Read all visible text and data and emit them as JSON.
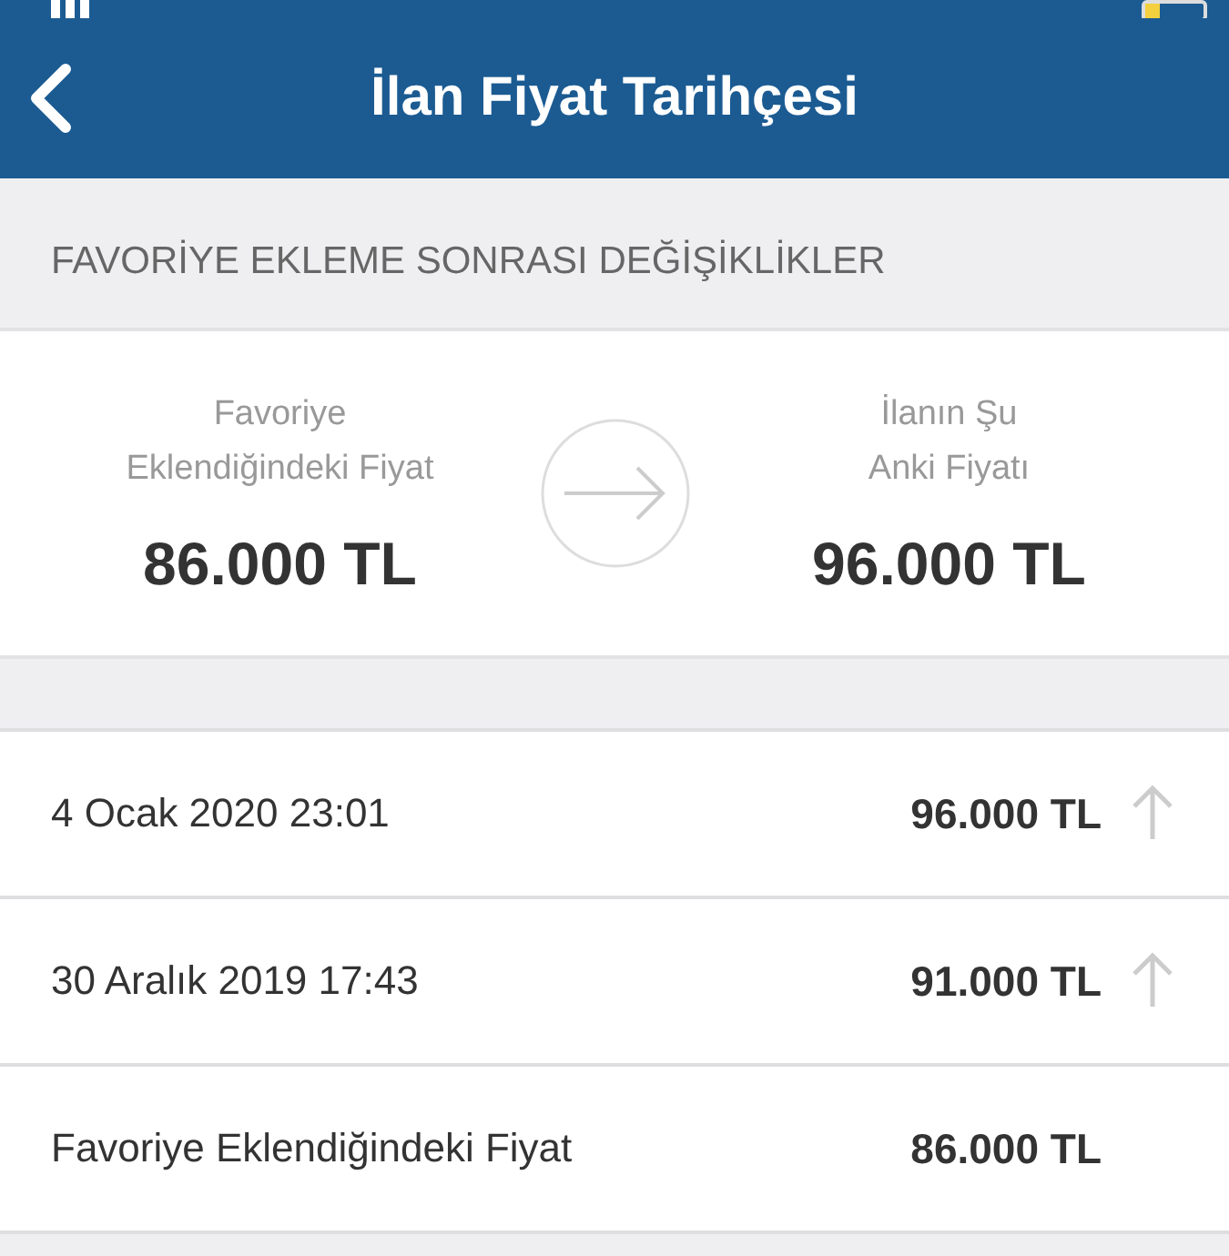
{
  "nav_bar": {
    "title": "İlan Fiyat Tarihçesi"
  },
  "section_header": "FAVORİYE EKLEME SONRASI DEĞİŞİKLİKLER",
  "comparison": {
    "from": {
      "label": "Favoriye Eklendiğindeki Fiyat",
      "price": "86.000 TL"
    },
    "to": {
      "label": "İlanın Şu Anki Fiyatı",
      "price": "96.000 TL"
    }
  },
  "history": [
    {
      "date": "4 Ocak 2020 23:01",
      "price": "96.000 TL",
      "rising": true
    },
    {
      "date": "30 Aralık 2019 17:43",
      "price": "91.000 TL",
      "rising": true
    },
    {
      "date": "Favoriye Eklendiğindeki Fiyat",
      "price": "86.000 TL",
      "rising": false
    }
  ]
}
